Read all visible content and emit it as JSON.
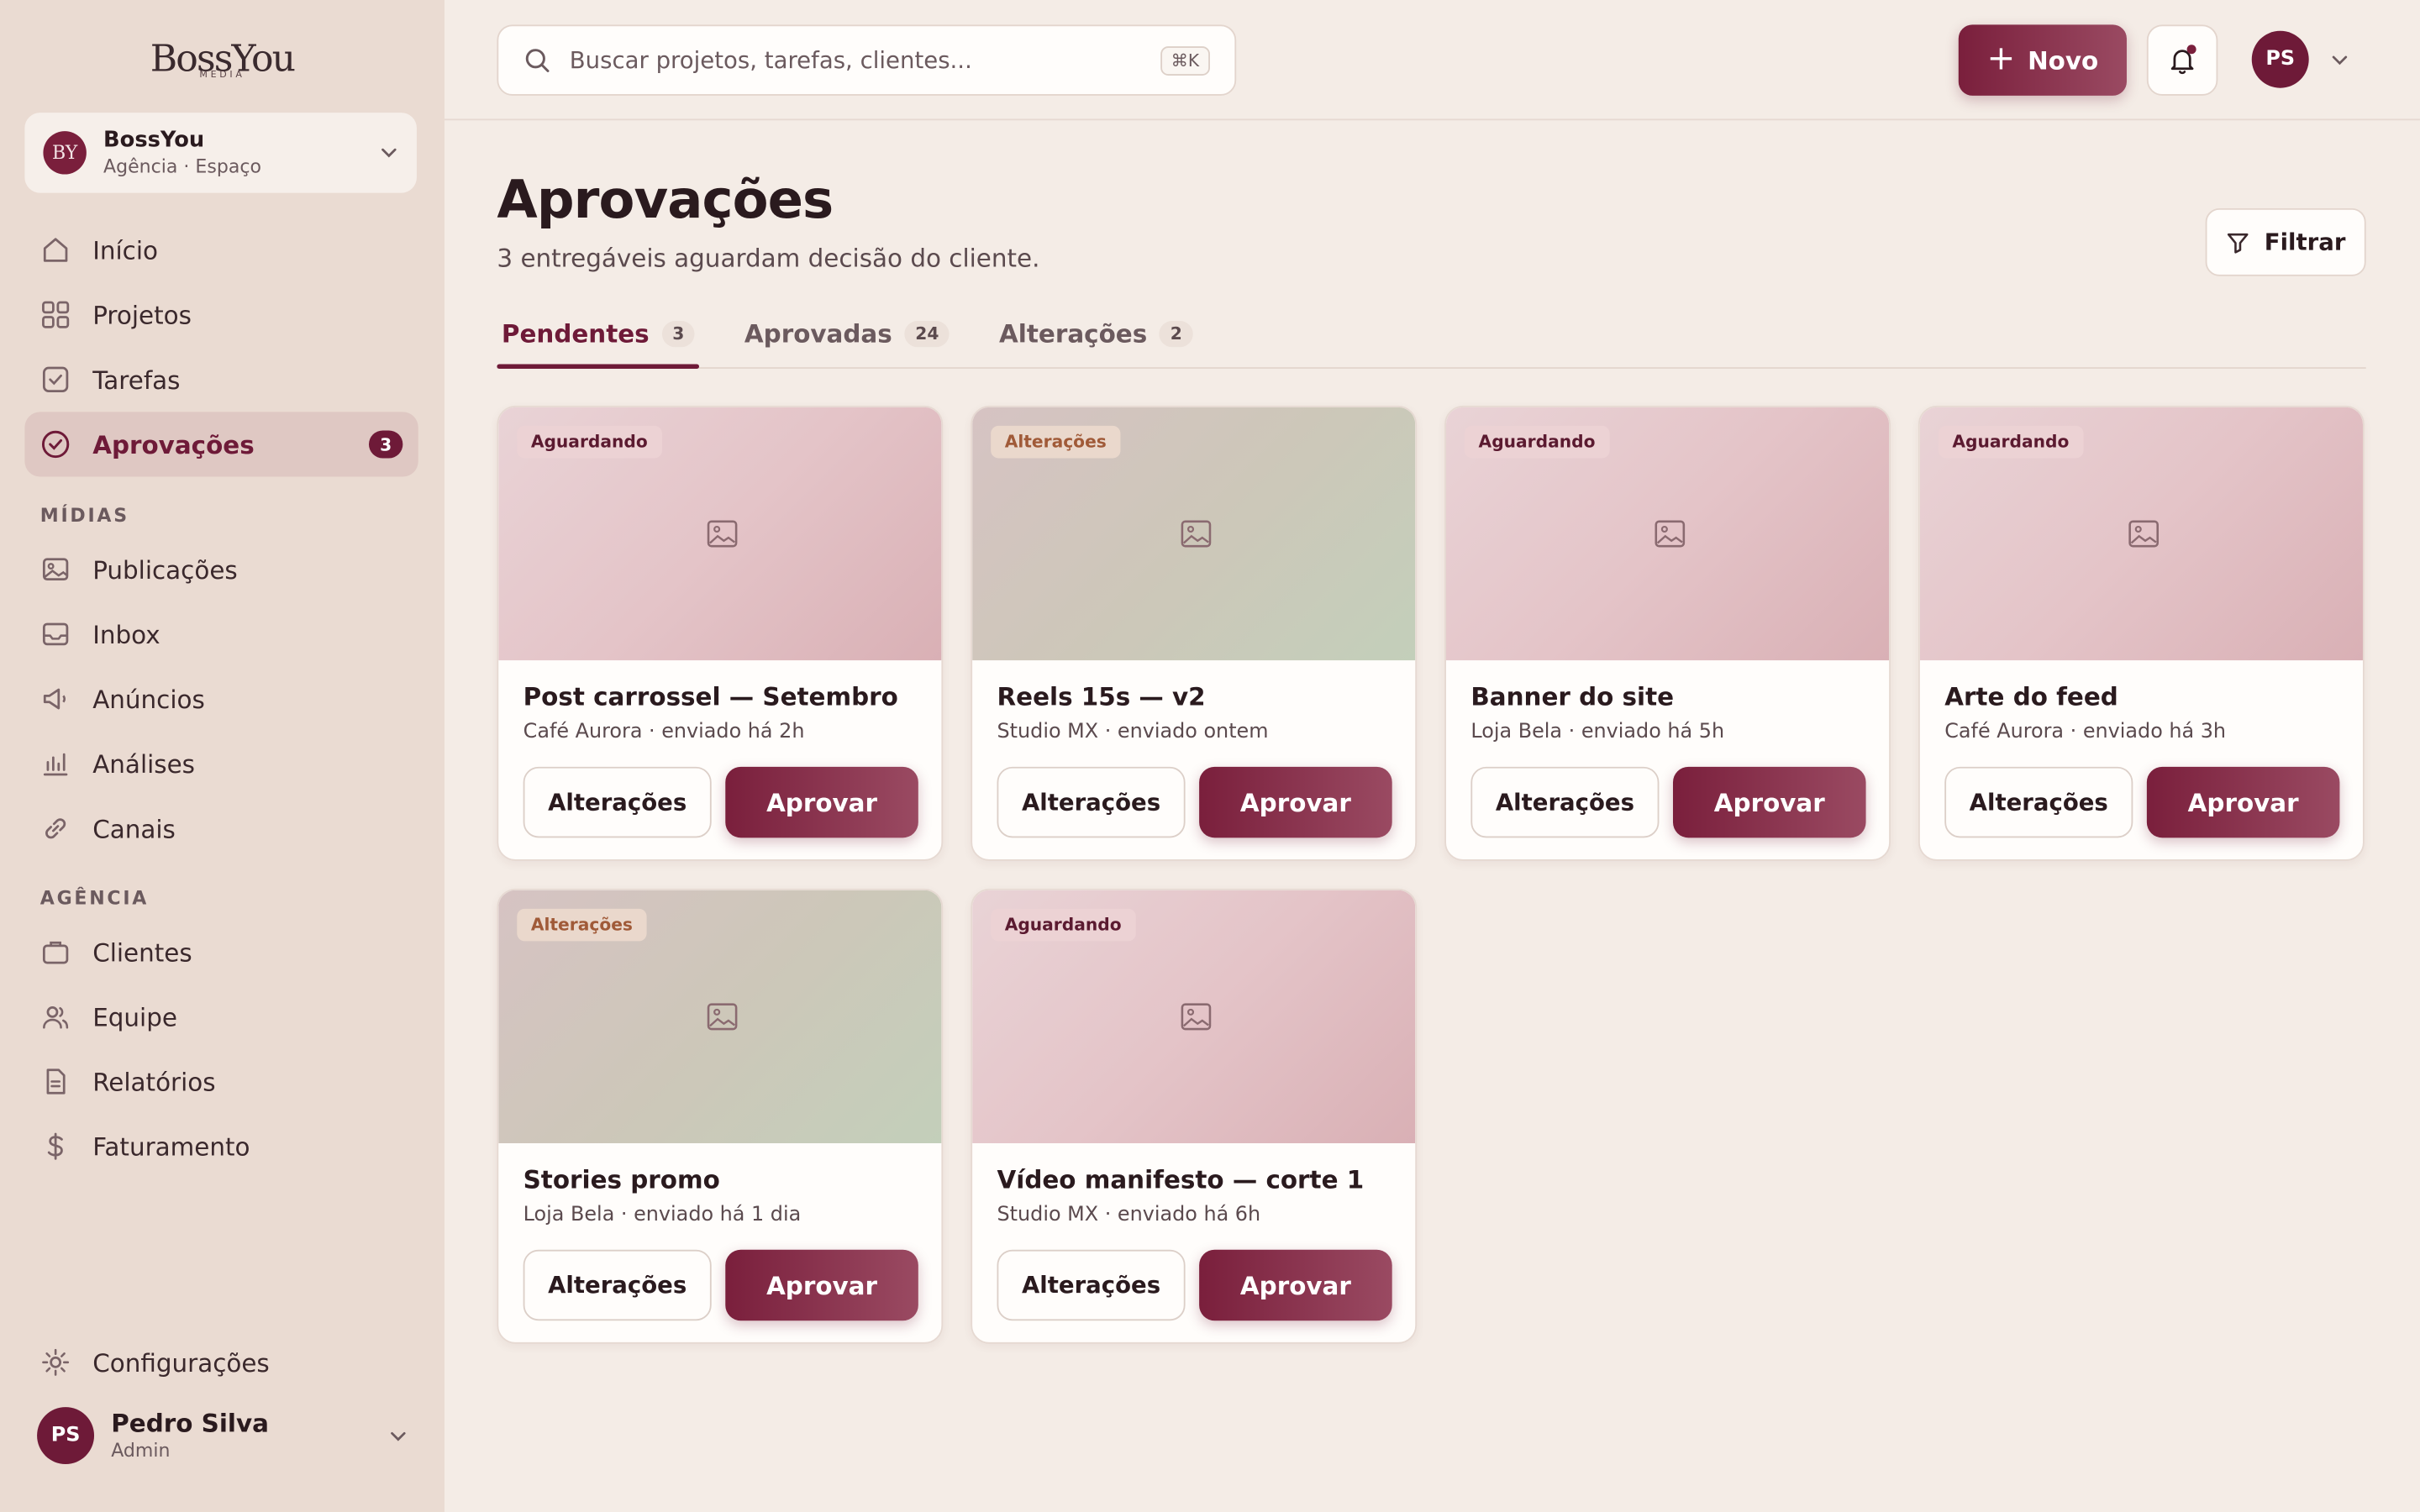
{
  "brand": {
    "logo": "BossYou",
    "logo_sub": "MEDIA"
  },
  "workspace": {
    "avatar": "BY",
    "name": "BossYou",
    "sub": "Agência · Espaço"
  },
  "nav_main": [
    {
      "label": "Início",
      "icon": "home-icon"
    },
    {
      "label": "Projetos",
      "icon": "grid-icon"
    },
    {
      "label": "Tarefas",
      "icon": "checkbox-icon"
    },
    {
      "label": "Aprovações",
      "icon": "check-circle-icon",
      "badge": "3",
      "active": true
    }
  ],
  "section_midias": "MÍDIAS",
  "nav_midias": [
    {
      "label": "Publicações",
      "icon": "image-icon"
    },
    {
      "label": "Inbox",
      "icon": "inbox-icon"
    },
    {
      "label": "Anúncios",
      "icon": "megaphone-icon"
    },
    {
      "label": "Análises",
      "icon": "bar-chart-icon"
    },
    {
      "label": "Canais",
      "icon": "link-icon"
    }
  ],
  "section_agencia": "AGÊNCIA",
  "nav_agencia": [
    {
      "label": "Clientes",
      "icon": "briefcase-icon"
    },
    {
      "label": "Equipe",
      "icon": "users-icon"
    },
    {
      "label": "Relatórios",
      "icon": "file-icon"
    },
    {
      "label": "Faturamento",
      "icon": "dollar-icon"
    }
  ],
  "settings": {
    "label": "Configurações",
    "icon": "sun-gear-icon"
  },
  "user": {
    "initials": "PS",
    "name": "Pedro Silva",
    "role": "Admin"
  },
  "search": {
    "placeholder": "Buscar projetos, tarefas, clientes...",
    "shortcut": "⌘K"
  },
  "header": {
    "new_label": "Novo",
    "avatar_initials": "PS"
  },
  "page": {
    "title": "Aprovações",
    "subtitle": "3 entregáveis aguardam decisão do cliente.",
    "filter_label": "Filtrar"
  },
  "tabs": [
    {
      "label": "Pendentes",
      "count": "3",
      "active": true
    },
    {
      "label": "Aprovadas",
      "count": "24"
    },
    {
      "label": "Alterações",
      "count": "2"
    }
  ],
  "card_actions": {
    "changes": "Alterações",
    "approve": "Aprovar"
  },
  "cards": [
    {
      "status": "Aguardando",
      "status_type": "wait",
      "tone": "pink",
      "title": "Post carrossel — Setembro",
      "meta": "Café Aurora · enviado há 2h"
    },
    {
      "status": "Alterações",
      "status_type": "change",
      "tone": "green",
      "title": "Reels 15s — v2",
      "meta": "Studio MX · enviado ontem"
    },
    {
      "status": "Aguardando",
      "status_type": "wait",
      "tone": "pink",
      "title": "Banner do site",
      "meta": "Loja Bela · enviado há 5h"
    },
    {
      "status": "Aguardando",
      "status_type": "wait",
      "tone": "pink",
      "title": "Arte do feed",
      "meta": "Café Aurora · enviado há 3h"
    },
    {
      "status": "Alterações",
      "status_type": "change",
      "tone": "green",
      "title": "Stories promo",
      "meta": "Loja Bela · enviado há 1 dia"
    },
    {
      "status": "Aguardando",
      "status_type": "wait",
      "tone": "pink",
      "title": "Vídeo manifesto — corte 1",
      "meta": "Studio MX · enviado há 6h"
    }
  ],
  "colors": {
    "accent": "#7a1f3c",
    "sidebar": "#eadbd2",
    "background": "#f4ece6"
  }
}
